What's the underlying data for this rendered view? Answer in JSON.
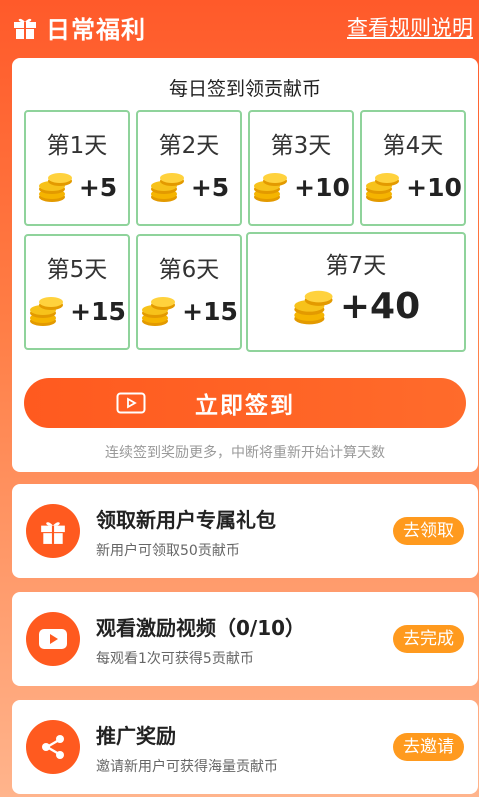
{
  "header": {
    "title": "日常福利",
    "rules_link": "查看规则说明"
  },
  "checkin": {
    "title": "每日签到领贡献币",
    "days": [
      {
        "label": "第1天",
        "reward": "+5"
      },
      {
        "label": "第2天",
        "reward": "+5"
      },
      {
        "label": "第3天",
        "reward": "+10"
      },
      {
        "label": "第4天",
        "reward": "+10"
      },
      {
        "label": "第5天",
        "reward": "+15"
      },
      {
        "label": "第6天",
        "reward": "+15"
      },
      {
        "label": "第7天",
        "reward": "+40"
      }
    ],
    "button_label": "立即签到",
    "hint": "连续签到奖励更多，中断将重新开始计算天数"
  },
  "tasks": [
    {
      "title": "领取新用户专属礼包",
      "desc": "新用户可领取50贡献币",
      "button": "去领取",
      "icon": "gift-icon"
    },
    {
      "title": "观看激励视频（0/10）",
      "desc": "每观看1次可获得5贡献币",
      "button": "去完成",
      "icon": "play-video-icon"
    },
    {
      "title": "推广奖励",
      "desc": "邀请新用户可获得海量贡献币",
      "button": "去邀请",
      "icon": "share-icon"
    }
  ],
  "colors": {
    "accent": "#ff5a1f",
    "task_button": "#ff9a1e",
    "day_border": "#8fd39b",
    "coin": "#f5b400"
  }
}
